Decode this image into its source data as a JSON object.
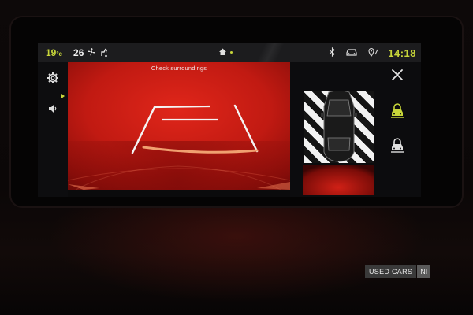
{
  "status_bar": {
    "outside_temp": "19",
    "outside_temp_unit": "°c",
    "cabin_temp": "26",
    "fan_icon": "fan-icon",
    "seat_icon": "heated-seat-icon",
    "home_icon": "home-icon",
    "bluetooth_icon": "bluetooth-icon",
    "car_icon": "car-settings-icon",
    "location_icon": "location-icon",
    "clock": "14:18"
  },
  "left_rail": {
    "settings_icon": "gear-icon",
    "sound_icon": "speaker-icon"
  },
  "camera": {
    "message": "Check surroundings"
  },
  "right_rail": {
    "close_icon": "close-icon",
    "park_assist_icon": "car-lock-icon"
  },
  "watermark": {
    "label": "USED CARS",
    "suffix": "NI"
  },
  "colors": {
    "accent": "#c8d63a",
    "camera_red": "#c11a12",
    "screen_bg": "#0b0b0c"
  }
}
